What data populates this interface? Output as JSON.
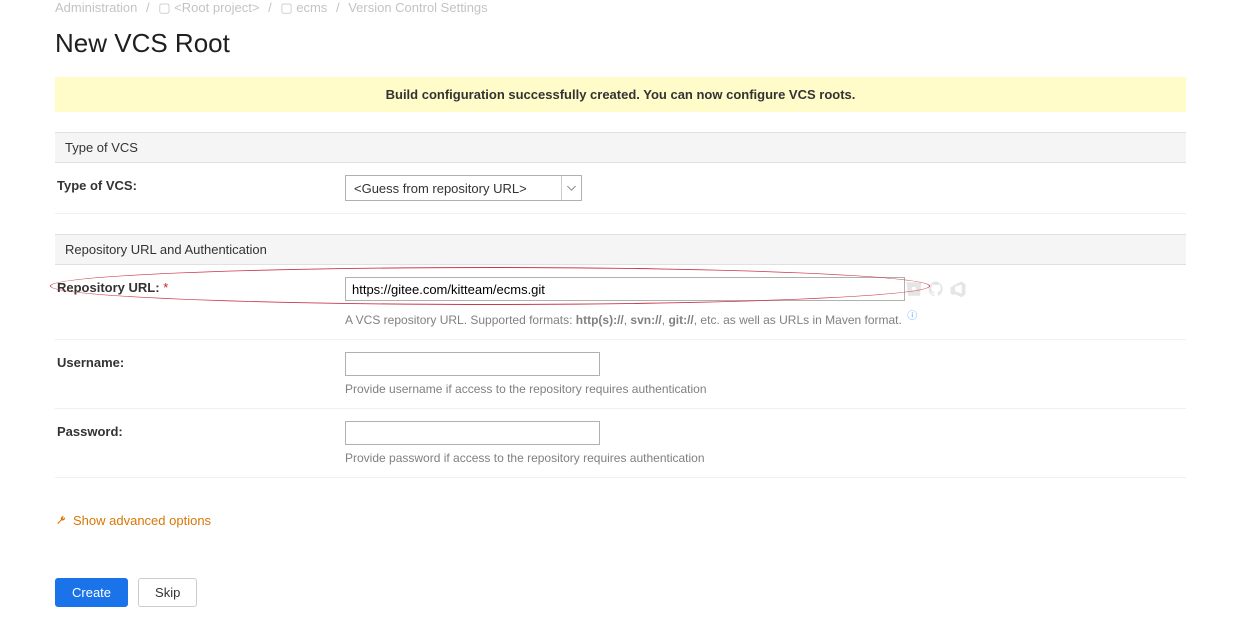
{
  "breadcrumb": {
    "root": "Administration",
    "project_prefix": "<Root project>",
    "project": "ecms",
    "page": "Version Control Settings"
  },
  "page_title": "New VCS Root",
  "banner": "Build configuration successfully created. You can now configure VCS roots.",
  "section1": {
    "header": "Type of VCS",
    "vcs_type_label": "Type of VCS:",
    "vcs_type_value": "<Guess from repository URL>"
  },
  "section2": {
    "header": "Repository URL and Authentication",
    "url_label": "Repository URL:",
    "url_value": "https://gitee.com/kitteam/ecms.git",
    "url_hint_pre": "A VCS repository URL. Supported formats: ",
    "url_hint_fmt1": "http(s)://",
    "url_hint_sep1": ", ",
    "url_hint_fmt2": "svn://",
    "url_hint_sep2": ", ",
    "url_hint_fmt3": "git://",
    "url_hint_post": ", etc. as well as URLs in Maven format.",
    "username_label": "Username:",
    "username_value": "",
    "username_hint": "Provide username if access to the repository requires authentication",
    "password_label": "Password:",
    "password_value": "",
    "password_hint": "Provide password if access to the repository requires authentication"
  },
  "advanced_label": "Show advanced options",
  "buttons": {
    "create": "Create",
    "skip": "Skip"
  }
}
